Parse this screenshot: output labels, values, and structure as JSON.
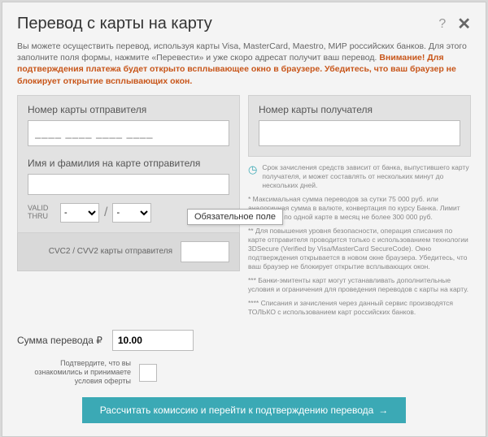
{
  "header": {
    "title": "Перевод с карты на карту",
    "help": "?",
    "close": "✕"
  },
  "intro": {
    "text": "Вы можете осуществить перевод, используя карты Visa, MasterCard, Maestro, МИР российских банков. Для этого заполните поля формы, нажмите «Перевести» и уже скоро адресат получит ваш перевод. ",
    "warning": "Внимание! Для подтверждения платежа будет открыто всплывающее окно в браузере. Убедитесь, что ваш браузер не блокирует открытие всплывающих окон."
  },
  "sender": {
    "card_label": "Номер карты отправителя",
    "card_placeholder": "____ ____ ____ ____",
    "name_label": "Имя и фамилия на карте отправителя",
    "valid_label": "VALID THRU",
    "month": "-",
    "year": "-",
    "cvc_label": "CVC2 / CVV2 карты отправителя"
  },
  "recipient": {
    "card_label": "Номер карты получателя"
  },
  "tooltip": "Обязательное поле",
  "fine": {
    "clock": "Срок зачисления средств зависит от банка, выпустившего карту получателя, и может составлять от нескольких минут до нескольких дней.",
    "p1": "* Максимальная сумма переводов за сутки 75 000 руб. или аналогичная сумма в валюте, конвертация по курсу Банка. Лимит переводов по одной карте в месяц не более 300 000 руб.",
    "p2": "** Для повышения уровня безопасности, операция списания по карте отправителя проводится только с использованием технологии 3DSecure (Verified by Visa/MasterCard SecureCode). Окно подтверждения открывается в новом окне браузера. Убедитесь, что ваш браузер не блокирует открытие всплывающих окон.",
    "p3": "*** Банки-эмитенты карт могут устанавливать дополнительные условия и ограничения для проведения переводов с карты на карту.",
    "p4": "**** Списания и зачисления через данный сервис производятся ТОЛЬКО с использованием карт российских банков."
  },
  "amount": {
    "label": "Сумма перевода ₽",
    "value": "10.00"
  },
  "confirm": {
    "text": "Подтвердите, что вы ознакомились и принимаете условия оферты"
  },
  "submit": {
    "label": "Рассчитать комиссию и перейти к подтверждению перевода",
    "arrow": "→"
  }
}
